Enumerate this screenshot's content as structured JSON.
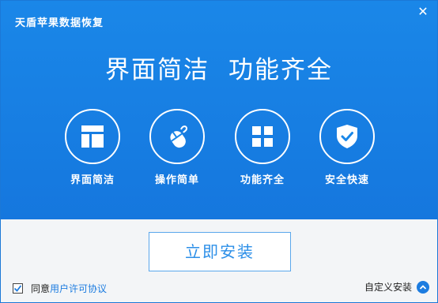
{
  "window": {
    "title": "天盾苹果数据恢复",
    "close_glyph": "✕"
  },
  "headline": {
    "part1": "界面简洁",
    "part2": "功能齐全"
  },
  "features": [
    {
      "label": "界面简洁",
      "icon": "layout-icon"
    },
    {
      "label": "操作简单",
      "icon": "mouse-icon"
    },
    {
      "label": "功能齐全",
      "icon": "grid-icon"
    },
    {
      "label": "安全快速",
      "icon": "shield-check-icon"
    }
  ],
  "install": {
    "label": "立即安装"
  },
  "footer": {
    "agree_prefix": "同意",
    "license_link": "用户许可协议",
    "custom_install": "自定义安装",
    "agree_checked": true
  },
  "colors": {
    "banner": "#1a87e8",
    "accent": "#1c7ce0",
    "background": "#f3f5f7"
  }
}
